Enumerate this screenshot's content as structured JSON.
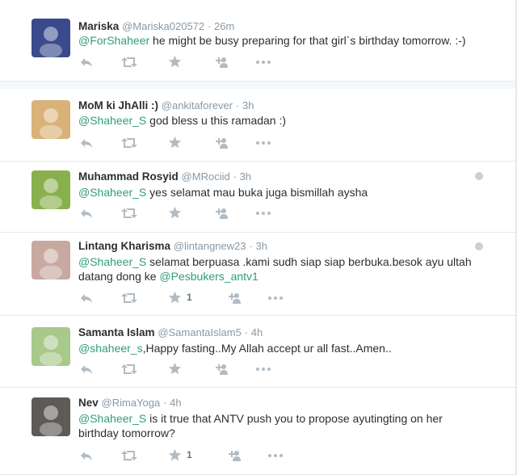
{
  "tweets": [
    {
      "fullname": "Mariska",
      "username": "@Mariska020572",
      "time": "26m",
      "mention": "@ForShaheer",
      "text_after": " he might be busy preparing for that girl`s birthday tomorrow. :-)",
      "mention2": "",
      "text_after2": "",
      "favorites": "",
      "geo": false,
      "avatar_color": "#3a4a8c"
    },
    {
      "fullname": "MoM ki JhAlli :)",
      "username": "@ankitaforever",
      "time": "3h",
      "mention": "@Shaheer_S",
      "text_after": " god bless u this ramadan :)",
      "mention2": "",
      "text_after2": "",
      "favorites": "",
      "geo": false,
      "avatar_color": "#d9b27a"
    },
    {
      "fullname": "Muhammad Rosyid",
      "username": "@MRociid",
      "time": "3h",
      "mention": "@Shaheer_S",
      "text_after": " yes selamat mau buka juga bismillah aysha",
      "mention2": "",
      "text_after2": "",
      "favorites": "",
      "geo": true,
      "avatar_color": "#8ab04e"
    },
    {
      "fullname": "Lintang Kharisma",
      "username": "@lintangnew23",
      "time": "3h",
      "mention": "@Shaheer_S",
      "text_after": " selamat berpuasa .kami sudh siap siap berbuka.besok ayu ultah datang dong ke ",
      "mention2": "@Pesbukers_antv1",
      "text_after2": "",
      "favorites": "1",
      "geo": true,
      "avatar_color": "#c8a9a0"
    },
    {
      "fullname": "Samanta Islam",
      "username": "@SamantaIslam5",
      "time": "4h",
      "mention": "@shaheer_s",
      "text_after": ",Happy fasting..My Allah accept ur all fast..Amen..",
      "mention2": "",
      "text_after2": "",
      "favorites": "",
      "geo": false,
      "avatar_color": "#a7c98a"
    },
    {
      "fullname": "Nev",
      "username": "@RimaYoga",
      "time": "4h",
      "mention": "@Shaheer_S",
      "text_after": "  is it true that ANTV push you to propose ayutingting on her birthday tomorrow?",
      "mention2": "",
      "text_after2": "",
      "favorites": "1",
      "geo": false,
      "avatar_color": "#5d5a57"
    }
  ],
  "separator": "·",
  "actions": {
    "reply": "reply-icon",
    "retweet": "retweet-icon",
    "favorite": "star-icon",
    "follow": "follow-icon",
    "more": "more-icon"
  },
  "colors": {
    "mention": "#2f9e76",
    "meta": "#8899a6",
    "action": "#b1bbc3"
  }
}
